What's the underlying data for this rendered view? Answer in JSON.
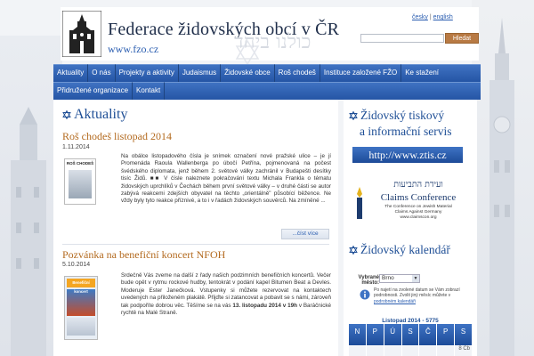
{
  "header": {
    "site_title": "Federace židovských obcí v ČR",
    "site_url": "www.fzo.cz",
    "motto_hebrew": "כולנו ביחד",
    "lang_cz": "česky",
    "lang_sep": "|",
    "lang_en": "english",
    "search_button": "Hledat",
    "search_value": ""
  },
  "nav": {
    "row1": [
      "Aktuality",
      "O nás",
      "Projekty a aktivity",
      "Judaismus",
      "Židovské obce",
      "Roš chodeš",
      "Instituce založené FŽO",
      "Ke stažení"
    ],
    "row2": [
      "Přidružené organizace",
      "Kontakt"
    ]
  },
  "main": {
    "section_title": "Aktuality",
    "news": [
      {
        "title": "Roš chodeš listopad 2014",
        "date": "1.11.2014",
        "thumb_label": "ROŠ CHODEŠ",
        "body": "Na obálce listopadového čísla je snímek označení nové pražské ulice – je jí Promenáda Raoula Wallenberga po úbočí Petřína, pojmenovaná na počest švédského diplomata, jenž během 2. světové války zachránil v Budapešti desítky tisíc Židů. ■■ V čísle naleznete pokračování textu Michala Frankla o tématu židovských uprchlíků v Čechách během první světové války – v druhé části se autor zabývá reakcemi zdejších obyvatel na těchto „orientálně\" působící běžence. Ne vždy byly tyto reakce příznivé, a to i v řadách židovských souvěrců. Na zmíněné ...",
        "read_more": "...číst více"
      },
      {
        "title": "Pozvánka na benefiční koncert NFOH",
        "date": "5.10.2014",
        "thumb_label": "Benefiční koncert",
        "body_pre": "Srdečně Vás zveme na další z řady našich podzimních benefičních koncertů. Večer bude opět v rytmu rockové hudby, tentokrát v podání kapel Bitumen Beat a Devles. Moderuje Ester Janečková. Vstupenky si můžete rezervovat na kontaktech uvedených na přiloženém plakátě. Přijďte si zatancovat a pobavit se s námi, zároveň tak podpoříte dobrou věc. Těšíme se na vás ",
        "body_strong": "13. listopadu 2014 v 19h",
        "body_post": " v Baráčnické rychtě na Malé Straně.",
        "read_more": "...číst více"
      }
    ]
  },
  "sidebar": {
    "press_title_line1": "Židovský tiskový",
    "press_title_line2": "a informační servis",
    "ztis_url": "http://www.ztis.cz",
    "claims_hebrew": "ועידת התביעות",
    "claims_title": "Claims Conference",
    "claims_sub1": "The Conference on Jewish Material",
    "claims_sub2": "Claims Against Germany",
    "claims_url": "www.claimscon.org",
    "calendar_title": "Židovský kalendář",
    "select_label": "Vybrané město:",
    "selected_city": "Brno",
    "note_line1": "Po najetí na zvolené datum se Vám zobrazí",
    "note_line2": "podrobnosti. Zvolit jiný měsíc můžete v",
    "note_link": "podrobném kalendáři",
    "month_header": "Listopad 2014 - 5775",
    "day_heads": [
      "N",
      "P",
      "Ú",
      "S",
      "Č",
      "P",
      "S"
    ],
    "first_cell": "8 Cb"
  },
  "colors": {
    "nav_blue": "#2555a5",
    "title_blue": "#1f4f96",
    "news_orange": "#b36a1f",
    "button_brown": "#b87a44"
  }
}
